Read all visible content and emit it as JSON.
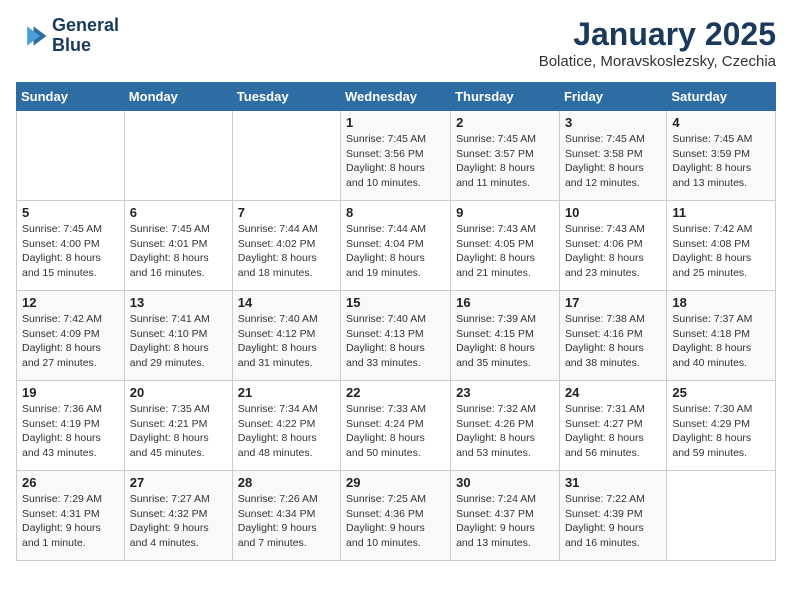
{
  "logo": {
    "line1": "General",
    "line2": "Blue"
  },
  "title": "January 2025",
  "subtitle": "Bolatice, Moravskoslezsky, Czechia",
  "weekdays": [
    "Sunday",
    "Monday",
    "Tuesday",
    "Wednesday",
    "Thursday",
    "Friday",
    "Saturday"
  ],
  "weeks": [
    [
      {
        "day": "",
        "text": ""
      },
      {
        "day": "",
        "text": ""
      },
      {
        "day": "",
        "text": ""
      },
      {
        "day": "1",
        "text": "Sunrise: 7:45 AM\nSunset: 3:56 PM\nDaylight: 8 hours\nand 10 minutes."
      },
      {
        "day": "2",
        "text": "Sunrise: 7:45 AM\nSunset: 3:57 PM\nDaylight: 8 hours\nand 11 minutes."
      },
      {
        "day": "3",
        "text": "Sunrise: 7:45 AM\nSunset: 3:58 PM\nDaylight: 8 hours\nand 12 minutes."
      },
      {
        "day": "4",
        "text": "Sunrise: 7:45 AM\nSunset: 3:59 PM\nDaylight: 8 hours\nand 13 minutes."
      }
    ],
    [
      {
        "day": "5",
        "text": "Sunrise: 7:45 AM\nSunset: 4:00 PM\nDaylight: 8 hours\nand 15 minutes."
      },
      {
        "day": "6",
        "text": "Sunrise: 7:45 AM\nSunset: 4:01 PM\nDaylight: 8 hours\nand 16 minutes."
      },
      {
        "day": "7",
        "text": "Sunrise: 7:44 AM\nSunset: 4:02 PM\nDaylight: 8 hours\nand 18 minutes."
      },
      {
        "day": "8",
        "text": "Sunrise: 7:44 AM\nSunset: 4:04 PM\nDaylight: 8 hours\nand 19 minutes."
      },
      {
        "day": "9",
        "text": "Sunrise: 7:43 AM\nSunset: 4:05 PM\nDaylight: 8 hours\nand 21 minutes."
      },
      {
        "day": "10",
        "text": "Sunrise: 7:43 AM\nSunset: 4:06 PM\nDaylight: 8 hours\nand 23 minutes."
      },
      {
        "day": "11",
        "text": "Sunrise: 7:42 AM\nSunset: 4:08 PM\nDaylight: 8 hours\nand 25 minutes."
      }
    ],
    [
      {
        "day": "12",
        "text": "Sunrise: 7:42 AM\nSunset: 4:09 PM\nDaylight: 8 hours\nand 27 minutes."
      },
      {
        "day": "13",
        "text": "Sunrise: 7:41 AM\nSunset: 4:10 PM\nDaylight: 8 hours\nand 29 minutes."
      },
      {
        "day": "14",
        "text": "Sunrise: 7:40 AM\nSunset: 4:12 PM\nDaylight: 8 hours\nand 31 minutes."
      },
      {
        "day": "15",
        "text": "Sunrise: 7:40 AM\nSunset: 4:13 PM\nDaylight: 8 hours\nand 33 minutes."
      },
      {
        "day": "16",
        "text": "Sunrise: 7:39 AM\nSunset: 4:15 PM\nDaylight: 8 hours\nand 35 minutes."
      },
      {
        "day": "17",
        "text": "Sunrise: 7:38 AM\nSunset: 4:16 PM\nDaylight: 8 hours\nand 38 minutes."
      },
      {
        "day": "18",
        "text": "Sunrise: 7:37 AM\nSunset: 4:18 PM\nDaylight: 8 hours\nand 40 minutes."
      }
    ],
    [
      {
        "day": "19",
        "text": "Sunrise: 7:36 AM\nSunset: 4:19 PM\nDaylight: 8 hours\nand 43 minutes."
      },
      {
        "day": "20",
        "text": "Sunrise: 7:35 AM\nSunset: 4:21 PM\nDaylight: 8 hours\nand 45 minutes."
      },
      {
        "day": "21",
        "text": "Sunrise: 7:34 AM\nSunset: 4:22 PM\nDaylight: 8 hours\nand 48 minutes."
      },
      {
        "day": "22",
        "text": "Sunrise: 7:33 AM\nSunset: 4:24 PM\nDaylight: 8 hours\nand 50 minutes."
      },
      {
        "day": "23",
        "text": "Sunrise: 7:32 AM\nSunset: 4:26 PM\nDaylight: 8 hours\nand 53 minutes."
      },
      {
        "day": "24",
        "text": "Sunrise: 7:31 AM\nSunset: 4:27 PM\nDaylight: 8 hours\nand 56 minutes."
      },
      {
        "day": "25",
        "text": "Sunrise: 7:30 AM\nSunset: 4:29 PM\nDaylight: 8 hours\nand 59 minutes."
      }
    ],
    [
      {
        "day": "26",
        "text": "Sunrise: 7:29 AM\nSunset: 4:31 PM\nDaylight: 9 hours\nand 1 minute."
      },
      {
        "day": "27",
        "text": "Sunrise: 7:27 AM\nSunset: 4:32 PM\nDaylight: 9 hours\nand 4 minutes."
      },
      {
        "day": "28",
        "text": "Sunrise: 7:26 AM\nSunset: 4:34 PM\nDaylight: 9 hours\nand 7 minutes."
      },
      {
        "day": "29",
        "text": "Sunrise: 7:25 AM\nSunset: 4:36 PM\nDaylight: 9 hours\nand 10 minutes."
      },
      {
        "day": "30",
        "text": "Sunrise: 7:24 AM\nSunset: 4:37 PM\nDaylight: 9 hours\nand 13 minutes."
      },
      {
        "day": "31",
        "text": "Sunrise: 7:22 AM\nSunset: 4:39 PM\nDaylight: 9 hours\nand 16 minutes."
      },
      {
        "day": "",
        "text": ""
      }
    ]
  ]
}
